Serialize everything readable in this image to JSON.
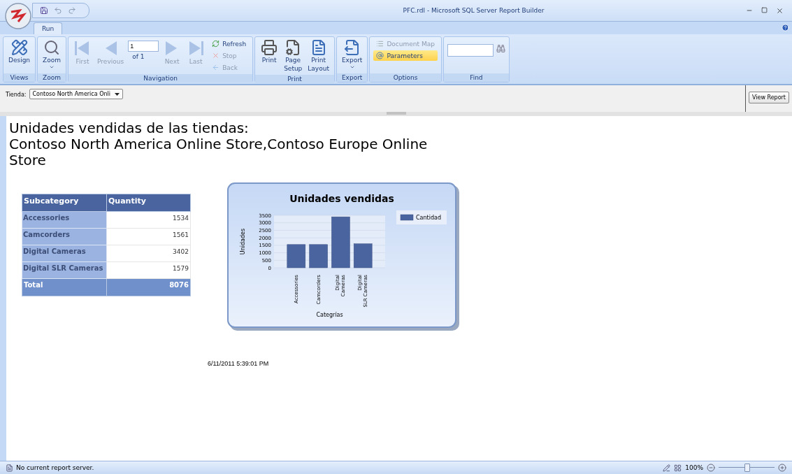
{
  "window": {
    "title": "PFC.rdl - Microsoft SQL Server Report Builder"
  },
  "tabs": [
    {
      "label": "Run",
      "selected": true
    }
  ],
  "ribbon": {
    "views": {
      "group_label": "Views",
      "button": {
        "label": "Design"
      }
    },
    "zoom": {
      "group_label": "Zoom",
      "button": {
        "label": "Zoom",
        "dropdown": true
      }
    },
    "navigation": {
      "group_label": "Navigation",
      "first": {
        "label": "First",
        "disabled": true
      },
      "previous": {
        "label": "Previous",
        "disabled": true
      },
      "page_field": {
        "value": "1"
      },
      "page_count": "of 1",
      "next": {
        "label": "Next",
        "disabled": true
      },
      "last": {
        "label": "Last",
        "disabled": true
      },
      "refresh": {
        "label": "Refresh",
        "disabled": false
      },
      "stop": {
        "label": "Stop",
        "disabled": true
      },
      "back": {
        "label": "Back",
        "disabled": true
      }
    },
    "print": {
      "group_label": "Print",
      "buttons": [
        {
          "kind": "print",
          "label": "Print"
        },
        {
          "kind": "setup",
          "label": "Page Setup"
        },
        {
          "kind": "layout",
          "label": "Print Layout"
        }
      ]
    },
    "export": {
      "group_label": "Export",
      "button": {
        "label": "Export",
        "dropdown": true
      }
    },
    "options": {
      "group_label": "Options",
      "items": [
        {
          "kind": "map",
          "label": "Document Map",
          "disabled": true,
          "selected": false
        },
        {
          "kind": "parameters",
          "label": "Parameters",
          "disabled": false,
          "selected": true
        }
      ]
    },
    "find": {
      "group_label": "Find"
    }
  },
  "parameters": {
    "label": "Tienda:",
    "value": "Contoso North America Onli",
    "view_report": "View Report"
  },
  "report": {
    "title_lines": [
      "Unidades vendidas de las tiendas:",
      "Contoso North America Online Store,Contoso Europe Online Store"
    ],
    "table": {
      "columns": [
        "Subcategory",
        "Quantity"
      ],
      "rows": [
        {
          "subcategory": "Accessories",
          "quantity": "1534"
        },
        {
          "subcategory": "Camcorders",
          "quantity": "1561"
        },
        {
          "subcategory": "Digital Cameras",
          "quantity": "3402"
        },
        {
          "subcategory": "Digital SLR Cameras",
          "quantity": "1579"
        }
      ],
      "total": {
        "label": "Total",
        "value": "8076"
      }
    },
    "chart_data": {
      "type": "bar",
      "title": "Unidades vendidas",
      "xlabel": "Categrías",
      "ylabel": "Unidades",
      "categories": [
        "Accessories",
        "Camcorders",
        "Digital Cameras",
        "Digital SLR Cameras"
      ],
      "series": [
        {
          "name": "Cantidad",
          "color": "#4a64a0",
          "values": [
            1550,
            1550,
            3400,
            1600
          ]
        }
      ],
      "grid": true,
      "ylim": [
        0,
        3500
      ],
      "yticks": [
        0,
        500,
        1000,
        1500,
        2000,
        2500,
        3000,
        3500
      ]
    },
    "timestamp": "6/11/2011 5:39:01 PM"
  },
  "status_bar": {
    "message": "No current report server.",
    "zoom": "100%",
    "zoom_slider": {
      "level": 0.5
    }
  }
}
